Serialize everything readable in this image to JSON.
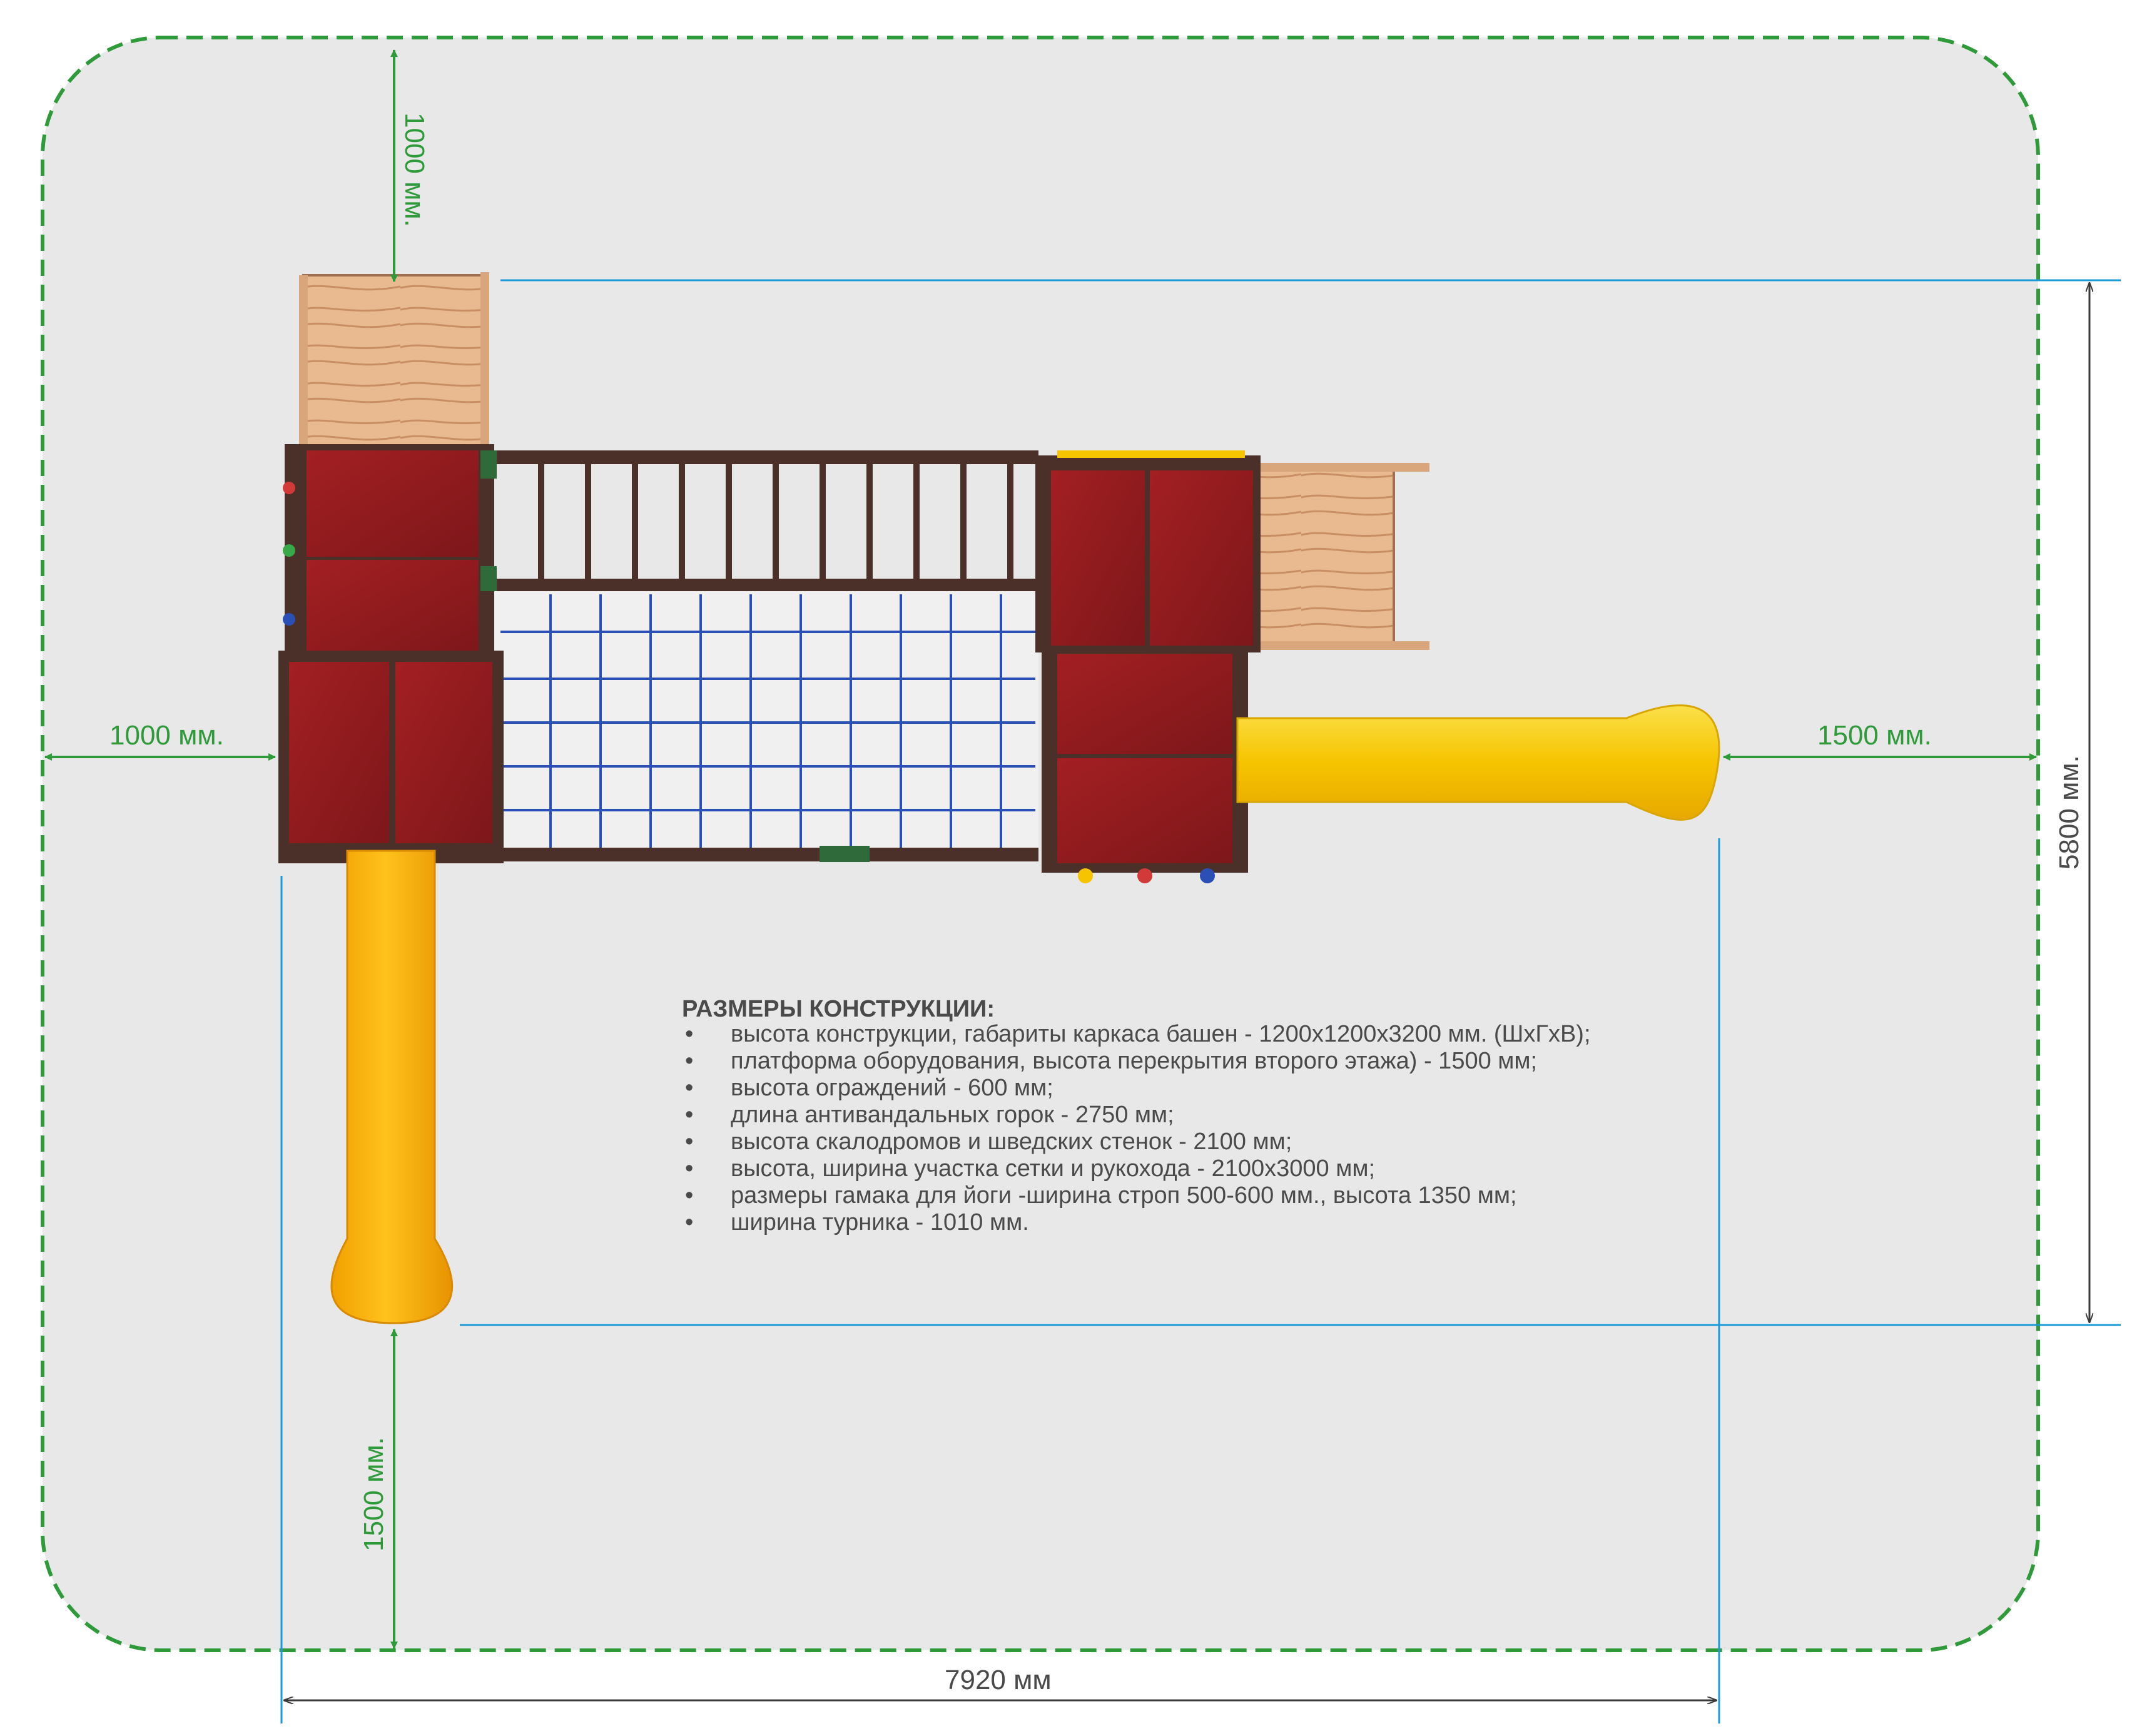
{
  "dimensions": {
    "top_clearance": "1000 мм.",
    "left_clearance": "1000 мм.",
    "right_clearance": "1500 мм.",
    "bottom_clearance": "1500 мм.",
    "depth": "5800 мм.",
    "length": "7920 мм"
  },
  "specs": {
    "title": "РАЗМЕРЫ КОНСТРУКЦИИ:",
    "bullet": "•",
    "items": [
      "высота конструкции, габариты каркаса башен - 1200х1200х3200 мм. (ШхГхВ);",
      "платформа оборудования, высота перекрытия второго этажа) - 1500 мм;",
      "высота ограждений - 600 мм;",
      "длина антивандальных горок - 2750 мм;",
      "высота скалодромов и шведских стенок - 2100 мм;",
      "высота, ширина участка сетки и рукохода - 2100х3000 мм;",
      "размеры гамака для йоги -ширина строп 500-600 мм., высота 1350 мм;",
      "ширина турника - 1010 мм."
    ]
  },
  "colors": {
    "safety_zone": "#2f9a3a",
    "zone_fill": "#e8e8e8",
    "dim_line": "#1a9bd7",
    "roof": "#8e1c1f",
    "frame": "#4a3028",
    "slide": "#f6c400",
    "net": "#2b4fb5"
  }
}
